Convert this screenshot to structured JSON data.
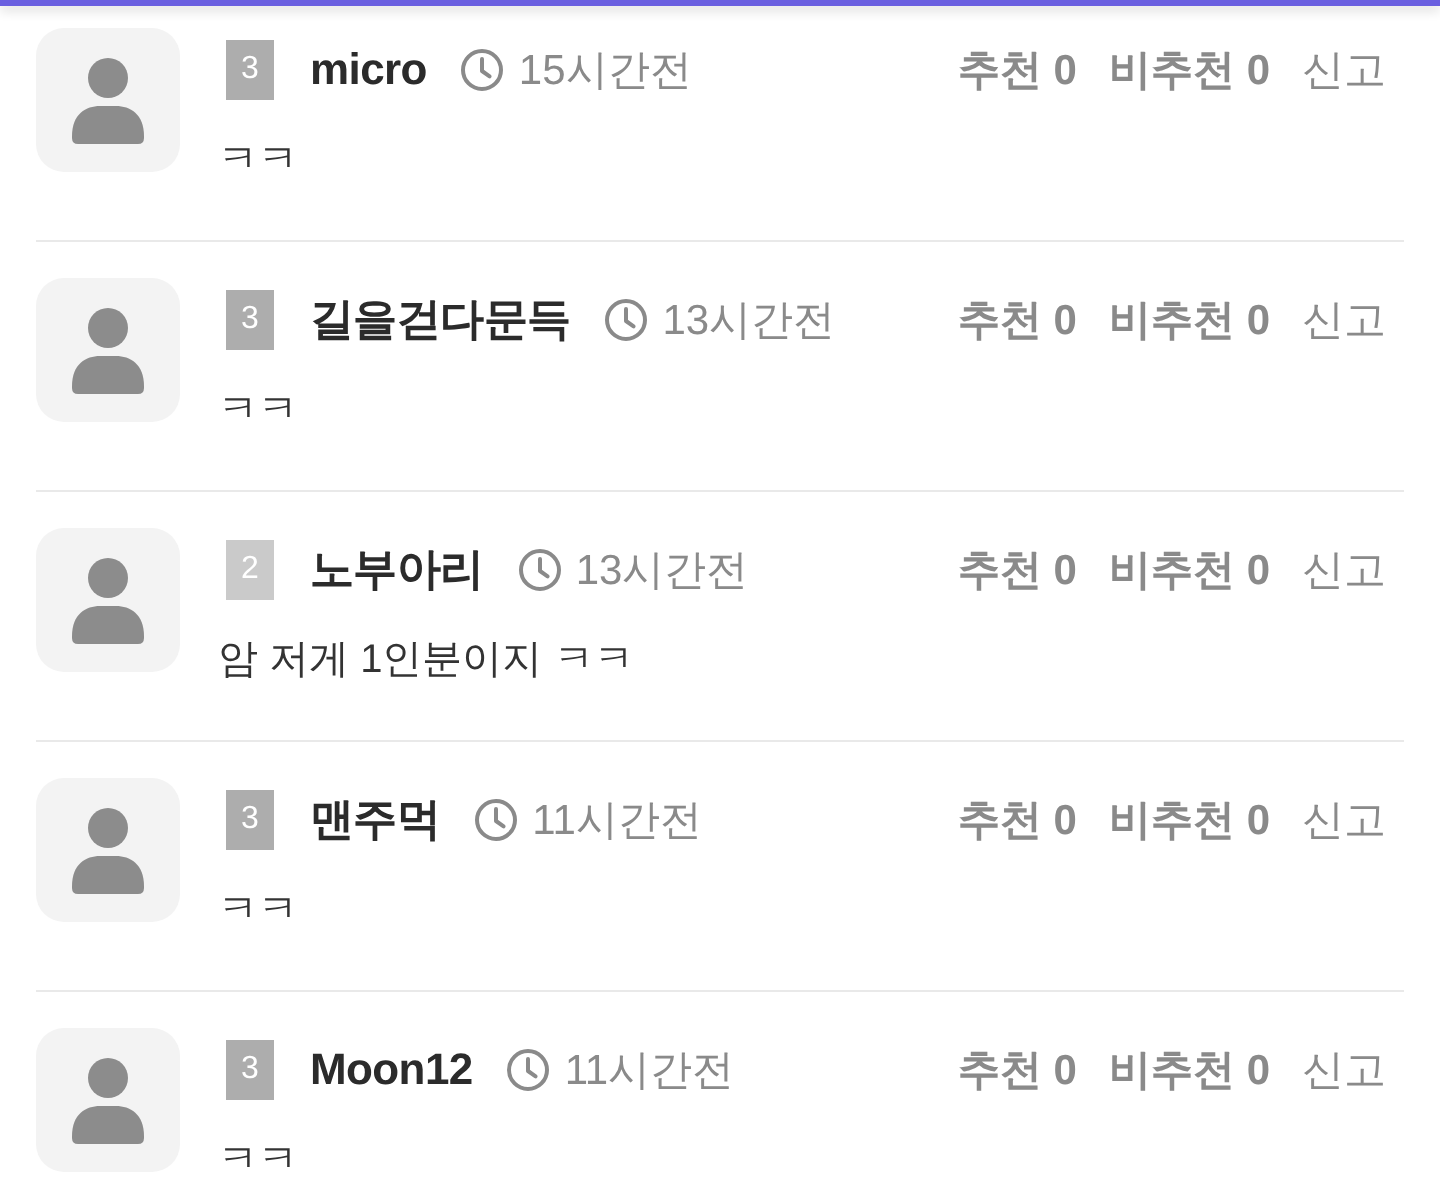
{
  "comments": [
    {
      "badge": {
        "text": "3",
        "color": "#adadad"
      },
      "name": "micro",
      "time": "15시간전",
      "likes": "추천 0",
      "dislikes": "비추천 0",
      "report": "신고",
      "text": "ㅋㅋ"
    },
    {
      "badge": {
        "text": "3",
        "color": "#adadad"
      },
      "name": "길을걷다문득",
      "time": "13시간전",
      "likes": "추천 0",
      "dislikes": "비추천 0",
      "report": "신고",
      "text": "ㅋㅋ"
    },
    {
      "badge": {
        "text": "2",
        "color": "#cacaca"
      },
      "name": "노부아리",
      "time": "13시간전",
      "likes": "추천 0",
      "dislikes": "비추천 0",
      "report": "신고",
      "text": "암 저게 1인분이지 ㅋㅋ"
    },
    {
      "badge": {
        "text": "3",
        "color": "#adadad"
      },
      "name": "맨주먹",
      "time": "11시간전",
      "likes": "추천 0",
      "dislikes": "비추천 0",
      "report": "신고",
      "text": "ㅋㅋ"
    },
    {
      "badge": {
        "text": "3",
        "color": "#adadad"
      },
      "name": "Moon12",
      "time": "11시간전",
      "likes": "추천 0",
      "dislikes": "비추천 0",
      "report": "신고",
      "text": "ㅋㅋ"
    }
  ]
}
